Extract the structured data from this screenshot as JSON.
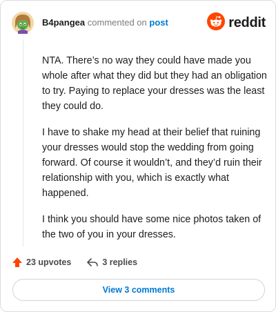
{
  "comment": {
    "username": "B4pangea",
    "commented_on_text": "commented on",
    "post_link_text": "post",
    "paragraphs": [
      "NTA. There’s no way they could have made you whole after what they did but they had an obligation to try. Paying to replace your dresses was the least they could do.",
      "I have to shake my head at their belief that ruining your dresses would stop the wedding from going forward. Of course it wouldn’t, and they’d ruin their relationship with you, which is exactly what happened.",
      "I think you should have some nice photos taken of the two of you in your dresses."
    ]
  },
  "brand": {
    "wordmark": "reddit",
    "logo_color": "#ff4500"
  },
  "actions": {
    "upvotes_label": "23 upvotes",
    "replies_label": "3 replies",
    "upvote_color": "#ff4500"
  },
  "footer": {
    "view_comments_label": "View 3 comments",
    "link_color": "#0079d3"
  },
  "icons": {
    "avatar": "snoo-avatar-icon",
    "logo": "reddit-logo-icon",
    "upvote": "upvote-arrow-icon",
    "reply": "reply-arrow-icon"
  }
}
